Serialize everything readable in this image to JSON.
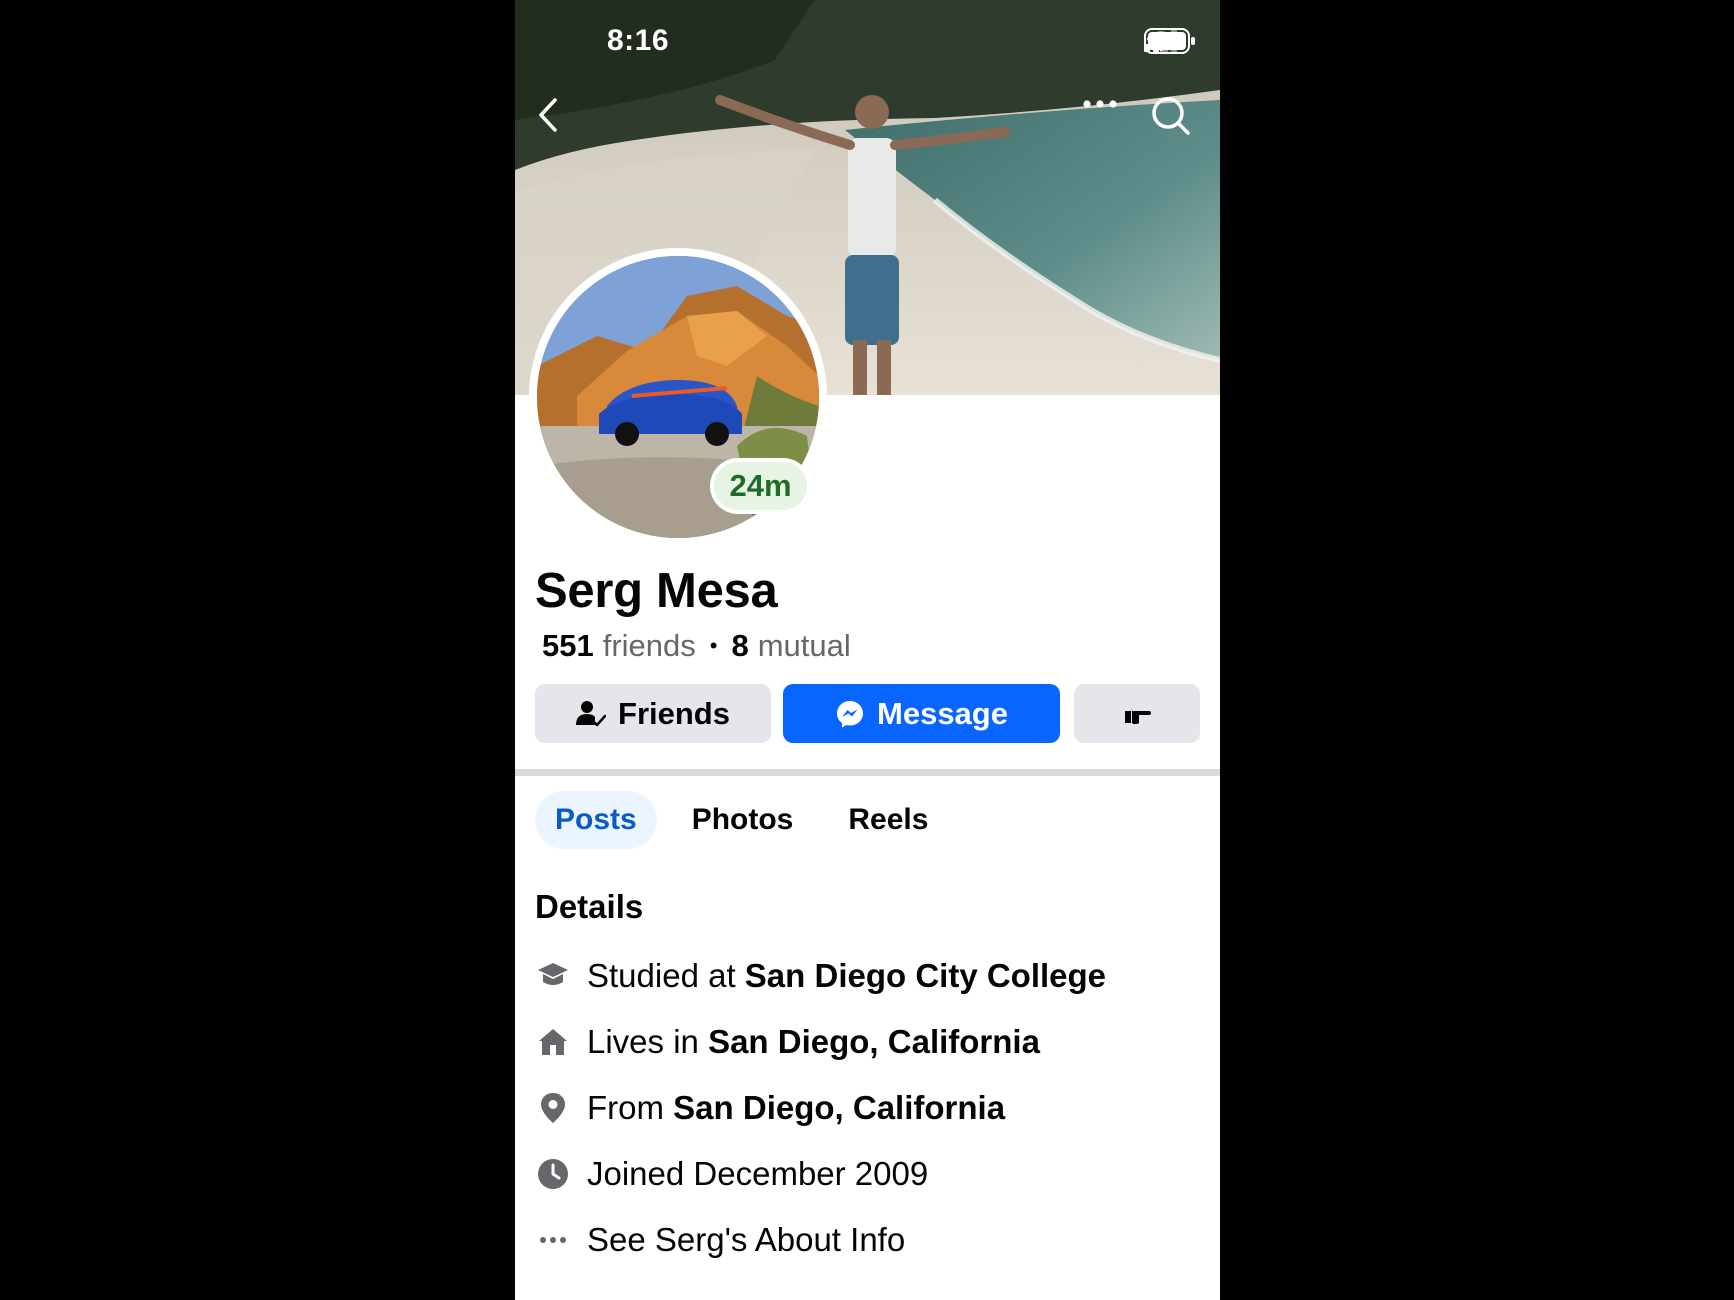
{
  "status_bar": {
    "time": "8:16"
  },
  "profile": {
    "name": "Serg Mesa",
    "active_badge": "24m",
    "friends_count": "551",
    "friends_label": "friends",
    "mutual_count": "8",
    "mutual_label": "mutual"
  },
  "actions": {
    "friends_label": "Friends",
    "message_label": "Message"
  },
  "tabs": [
    {
      "label": "Posts",
      "active": true
    },
    {
      "label": "Photos",
      "active": false
    },
    {
      "label": "Reels",
      "active": false
    }
  ],
  "details": {
    "title": "Details",
    "rows": [
      {
        "icon": "graduation-cap-icon",
        "prefix": "Studied at",
        "value": "San Diego City College"
      },
      {
        "icon": "home-icon",
        "prefix": "Lives in",
        "value": "San Diego, California"
      },
      {
        "icon": "location-pin-icon",
        "prefix": "From",
        "value": "San Diego, California"
      },
      {
        "icon": "clock-icon",
        "prefix": "Joined December 2009",
        "value": ""
      },
      {
        "icon": "more-dots-icon",
        "prefix": "See Serg's About Info",
        "value": ""
      }
    ]
  },
  "colors": {
    "primary": "#0866ff",
    "active_tab_bg": "#ebf5ff",
    "active_tab_text": "#0a5bc4",
    "badge_green": "#1f6b2a"
  }
}
